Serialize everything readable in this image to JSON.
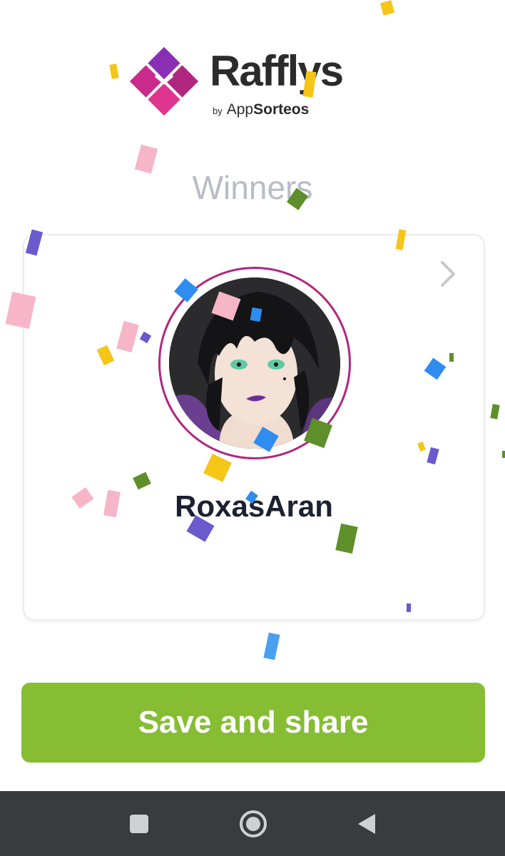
{
  "brand": {
    "name": "Rafflys",
    "by": "by",
    "app": "App",
    "sorteos": "Sorteos",
    "colors": {
      "mark_primary": "#b0277f",
      "mark_secondary": "#e0358f",
      "mark_accent": "#8a2fb3"
    }
  },
  "title": "Winners",
  "winner": {
    "name": "RoxasAran",
    "ring_color": "#b0277f"
  },
  "actions": {
    "save_share_label": "Save and share",
    "button_color": "#86bd33"
  },
  "nav": {
    "recents": "square-icon",
    "home": "circle-icon",
    "back": "triangle-back-icon"
  }
}
